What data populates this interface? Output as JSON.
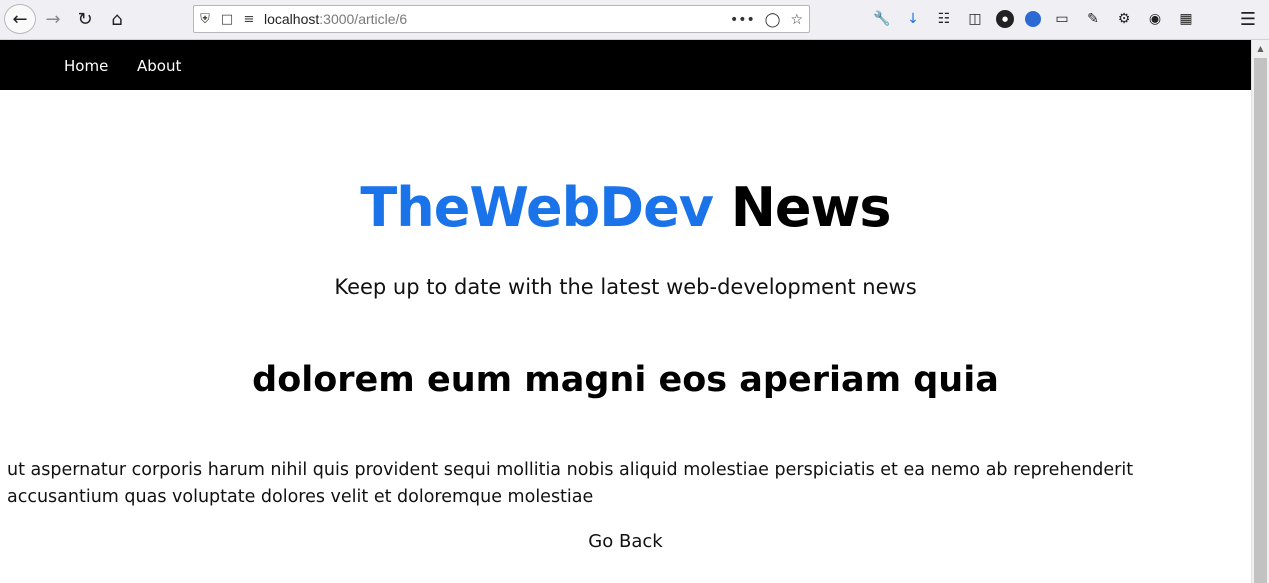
{
  "browser": {
    "url_host": "localhost",
    "url_path": ":3000/article/6"
  },
  "nav": {
    "home_label": "Home",
    "about_label": "About"
  },
  "header": {
    "brand": "TheWebDev",
    "title_rest": "News",
    "tagline": "Keep up to date with the latest web-development news"
  },
  "article": {
    "title": "dolorem eum magni eos aperiam quia",
    "body": "ut aspernatur corporis harum nihil quis provident sequi mollitia nobis aliquid molestiae perspiciatis et ea nemo ab reprehenderit accusantium quas voluptate dolores velit et doloremque molestiae",
    "back_label": "Go Back"
  },
  "colors": {
    "brand": "#1a73e8",
    "navbar": "#000000"
  }
}
